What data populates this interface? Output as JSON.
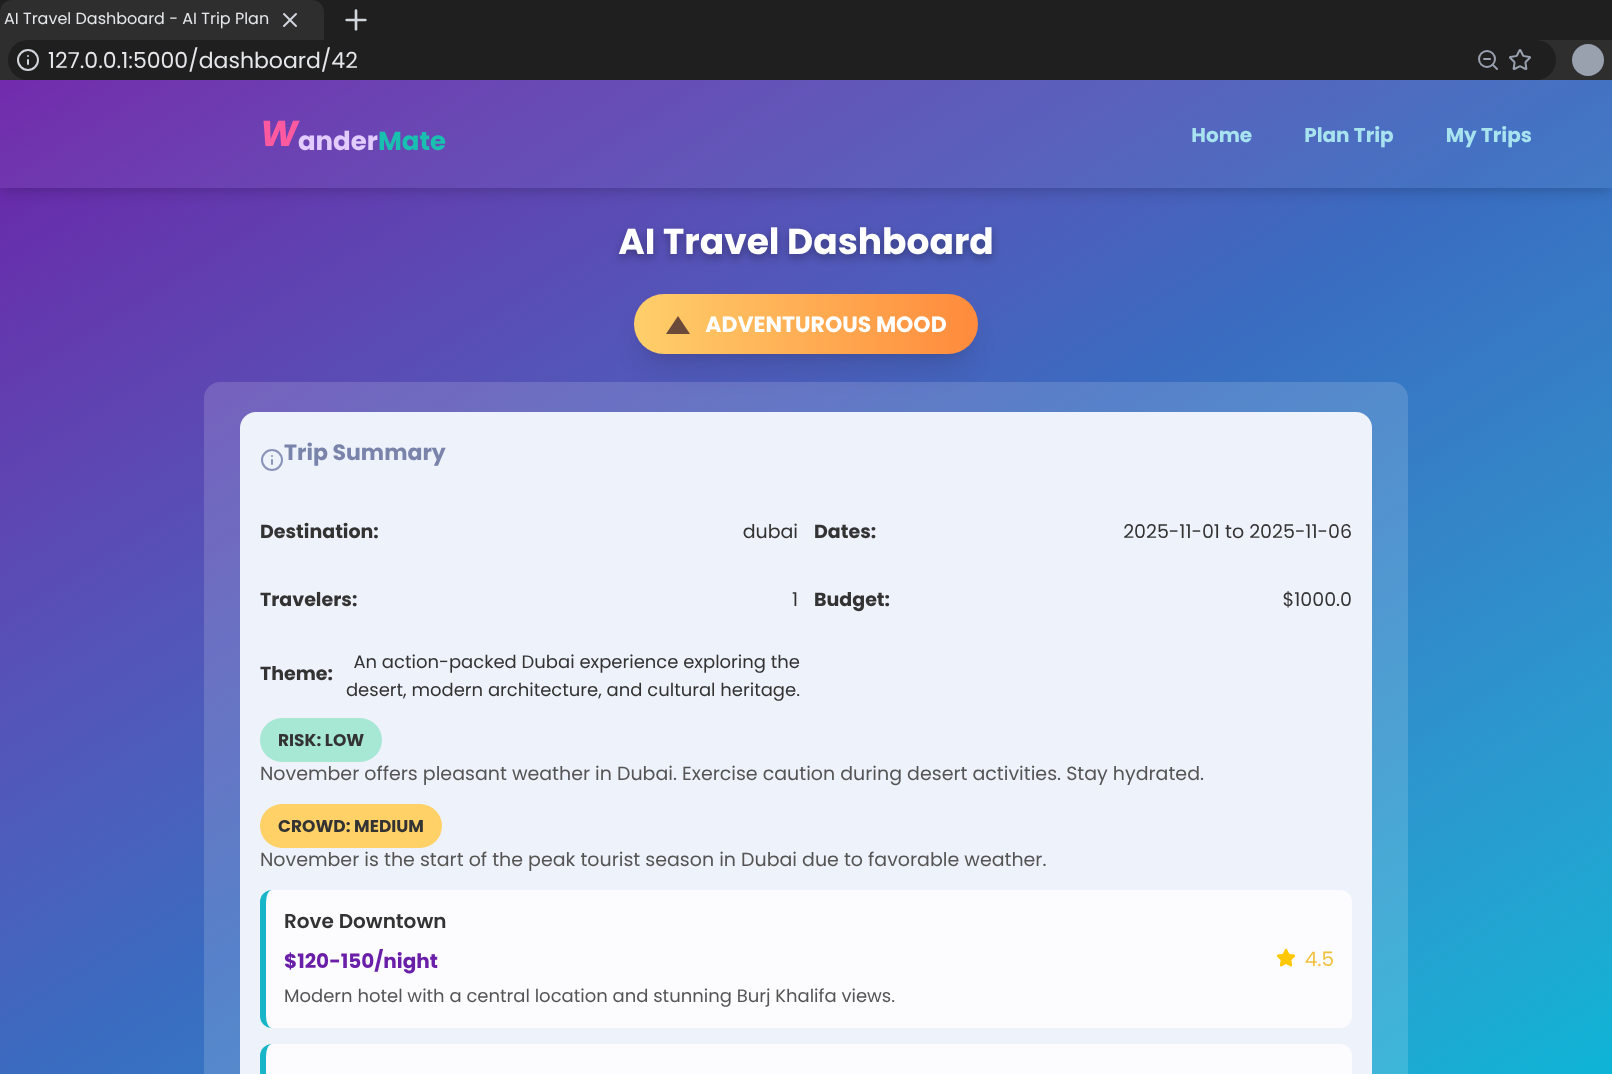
{
  "browser": {
    "tab_title": "AI Travel Dashboard - AI Trip Plan",
    "url": "127.0.0.1:5000/dashboard/42"
  },
  "nav": {
    "logo_first": "W",
    "logo_middle": "ander",
    "logo_last": "Mate",
    "links": [
      {
        "label": "Home",
        "selected": false
      },
      {
        "label": "Plan Trip",
        "selected": false
      },
      {
        "label": "My Trips",
        "selected": false
      }
    ]
  },
  "page_title": "AI Travel Dashboard",
  "mood": "ADVENTUROUS MOOD",
  "summary": {
    "title": "Trip Summary",
    "fields": [
      {
        "label": "Destination:",
        "value": "dubai"
      },
      {
        "label": "Dates:",
        "value": "2025-11-01 to 2025-11-06"
      },
      {
        "label": "Travelers:",
        "value": "1"
      },
      {
        "label": "Budget:",
        "value": "$1000.0"
      }
    ],
    "theme_label": "Theme:",
    "theme": "An action-packed Dubai experience exploring the desert, modern architecture, and cultural heritage.",
    "alerts": [
      {
        "badge": "RISK: LOW",
        "color": "#a7e8d4",
        "note": "November offers pleasant weather in Dubai. Exercise caution during desert activities. Stay hydrated."
      },
      {
        "badge": "CROWD: MEDIUM",
        "color": "#ffd166",
        "note": "November is the start of the peak tourist season in Dubai due to favorable weather."
      }
    ],
    "hotels": [
      {
        "name": "Rove Downtown",
        "price": "$120-150/night",
        "rating": "4.5",
        "description": "Modern hotel with a central location and stunning Burj Khalifa views."
      }
    ]
  }
}
